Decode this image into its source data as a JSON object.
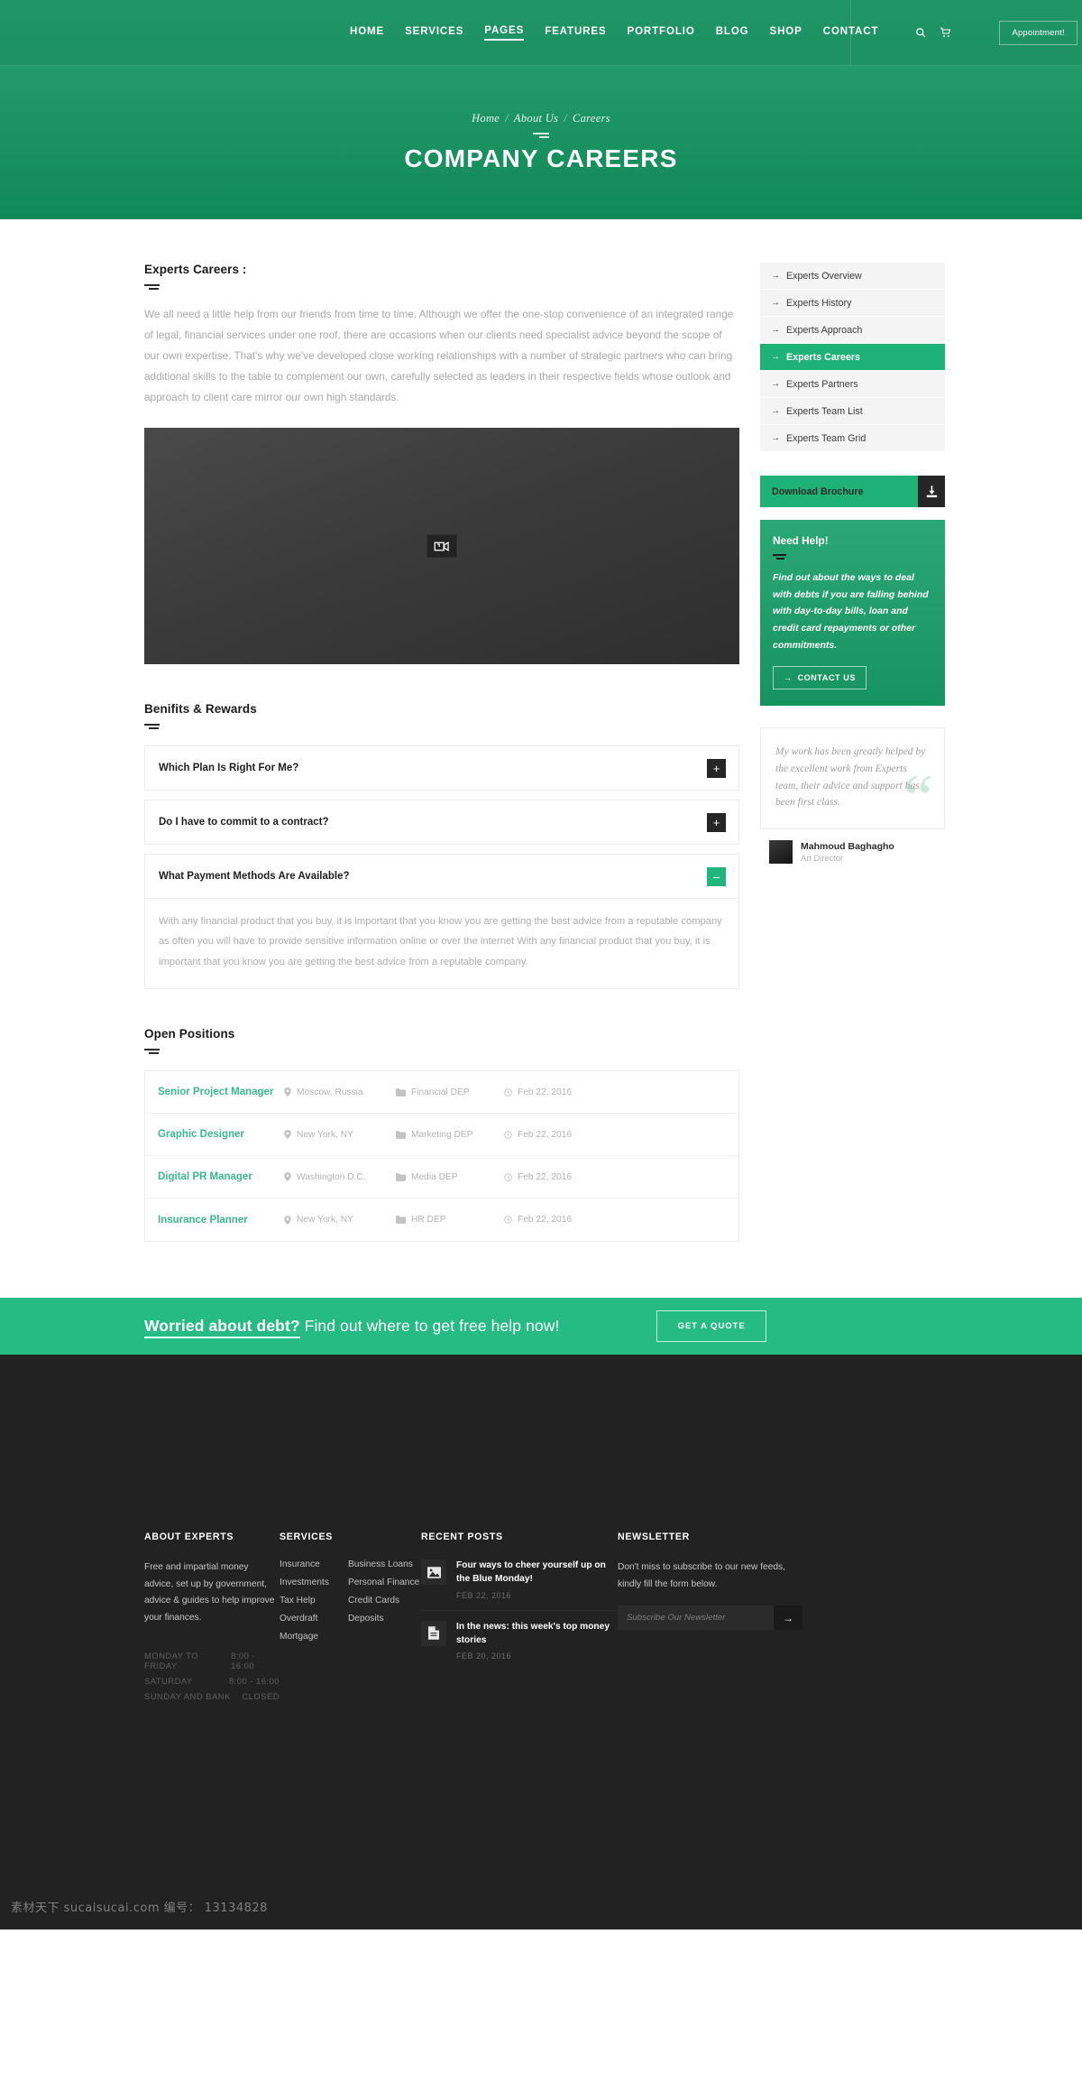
{
  "header": {
    "nav": [
      {
        "label": "HOME",
        "active": false
      },
      {
        "label": "SERVICES",
        "active": false
      },
      {
        "label": "PAGES",
        "active": true
      },
      {
        "label": "FEATURES",
        "active": false
      },
      {
        "label": "PORTFOLIO",
        "active": false
      },
      {
        "label": "BLOG",
        "active": false
      },
      {
        "label": "SHOP",
        "active": false
      },
      {
        "label": "CONTACT",
        "active": false
      }
    ],
    "search_icon": "search-icon",
    "cart_icon": "cart-icon",
    "appointment_label": "Appointment!",
    "accent": "#1fb277"
  },
  "hero": {
    "breadcrumb": [
      {
        "label": "Home"
      },
      {
        "label": "About Us"
      },
      {
        "label": "Careers"
      }
    ],
    "separator": "/",
    "title": "COMPANY CAREERS"
  },
  "intro": {
    "title": "Experts Careers :",
    "paragraph": "We all need a little help from our friends from time to time. Although we offer the one-stop convenience of an integrated range of legal, financial services under one roof, there are occasions when our clients need specialist advice beyond the scope of our own expertise. That's why we've developed close working relationships with a number of strategic partners who can bring additional skills to the table to complement our own, carefully selected as leaders in their respective fields whose outlook and approach to client care mirror our own high standards."
  },
  "video": {
    "icon": "video-placeholder-icon"
  },
  "benefits": {
    "title": "Benifits & Rewards",
    "items": [
      {
        "question": "Which Plan Is Right For Me?",
        "open": false,
        "toggle": "+",
        "answer": ""
      },
      {
        "question": "Do I have to commit to a contract?",
        "open": false,
        "toggle": "+",
        "answer": ""
      },
      {
        "question": "What Payment Methods Are Available?",
        "open": true,
        "toggle": "–",
        "answer": "With any financial product that you buy, it is important that you know you are getting the best advice from a reputable company as often you will have to provide sensitive information online or over the internet With any financial product that you buy, it is important that you know you are getting the best advice from a reputable company."
      }
    ]
  },
  "positions": {
    "title": "Open Positions",
    "rows": [
      {
        "title": "Senior Project Manager",
        "location": "Moscow, Russia",
        "department": "Financial DEP",
        "date": "Feb 22, 2016"
      },
      {
        "title": "Graphic Designer",
        "location": "New York, NY",
        "department": "Marketing DEP",
        "date": "Feb 22, 2016"
      },
      {
        "title": "Digital PR Manager",
        "location": "Washington D.C.",
        "department": "Media DEP",
        "date": "Feb 22, 2016"
      },
      {
        "title": "Insurance Planner",
        "location": "New York, NY",
        "department": "HR DEP",
        "date": "Feb 22, 2016"
      }
    ]
  },
  "sidebar": {
    "menu": [
      {
        "label": "Experts Overview",
        "active": false
      },
      {
        "label": "Experts History",
        "active": false
      },
      {
        "label": "Experts Approach",
        "active": false
      },
      {
        "label": "Experts Careers",
        "active": true
      },
      {
        "label": "Experts Partners",
        "active": false
      },
      {
        "label": "Experts Team List",
        "active": false
      },
      {
        "label": "Experts Team Grid",
        "active": false
      }
    ],
    "brochure": {
      "label": "Download Brochure",
      "icon": "download-icon"
    },
    "need_help": {
      "title": "Need Help!",
      "text": "Find out about the ways to deal with debts if you are falling behind with day-to-day bills, loan and credit card repayments or other commitments.",
      "button": "CONTACT US"
    },
    "testimonial": {
      "quote": "My work has been greatly helped by the excellent work from Experts team, their advice and support has been first class.",
      "quote_mark": "“",
      "author": "Mahmoud Baghagho",
      "role": "Art Director"
    }
  },
  "cta": {
    "bold": "Worried about debt?",
    "rest": " Find out where to get free help now!",
    "button": "GET A QUOTE",
    "background": "#26bb83"
  },
  "footer": {
    "about": {
      "title": "ABOUT EXPERTS",
      "text": "Free and impartial money advice, set up by government, advice & guides to help improve your finances.",
      "hours": [
        {
          "day": "MONDAY TO FRIDAY",
          "time": "8:00 - 16:00"
        },
        {
          "day": "SATURDAY",
          "time": "8:00 - 16:00"
        },
        {
          "day": "SUNDAY AND BANK",
          "time": "CLOSED"
        }
      ]
    },
    "services": {
      "title": "SERVICES",
      "col1": [
        "Insurance",
        "Investments",
        "Tax Help",
        "Overdraft",
        "Mortgage"
      ],
      "col2": [
        "Business Loans",
        "Personal Finance",
        "Credit Cards",
        "Deposits"
      ]
    },
    "recent_posts": {
      "title": "RECENT POSTS",
      "posts": [
        {
          "title": "Four ways to cheer yourself up on the Blue Monday!",
          "date": "FEB 22, 2016",
          "icon": "image-icon"
        },
        {
          "title": "In the news: this week's top money stories",
          "date": "FEB 20, 2016",
          "icon": "document-icon"
        }
      ]
    },
    "newsletter": {
      "title": "NEWSLETTER",
      "text": "Don't miss to subscribe to our new feeds, kindly fill the form below.",
      "placeholder": "Subscribe Our Newsletter",
      "submit_icon": "arrow-right-icon"
    }
  },
  "watermark": {
    "text": "素材天下 sucaisucai.com  编号： 13134828"
  }
}
